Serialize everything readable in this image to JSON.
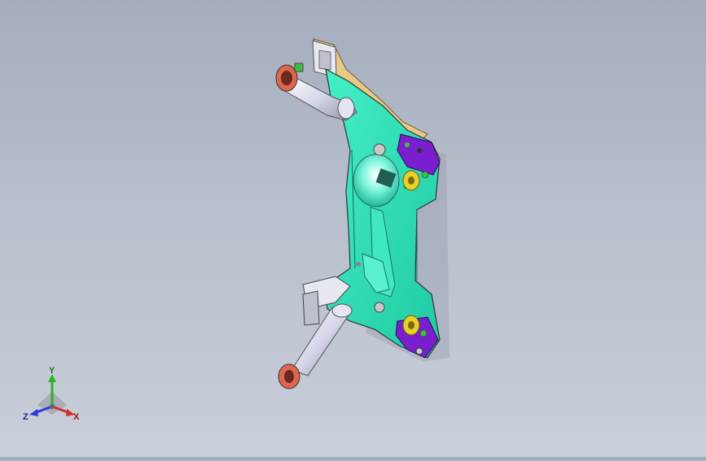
{
  "triad": {
    "x_label": "X",
    "y_label": "Y",
    "z_label": "Z",
    "x_color": "#d92b2b",
    "y_color": "#2bb22b",
    "z_color": "#2b3bd9"
  },
  "model": {
    "plate_color": "#2fe0b8",
    "bracket_color": "#7a1fcf",
    "bushing_color": "#e6d12a",
    "tube_color": "#d8d8ec",
    "flange_color": "#e0654f",
    "rail_color": "#e8c988"
  }
}
